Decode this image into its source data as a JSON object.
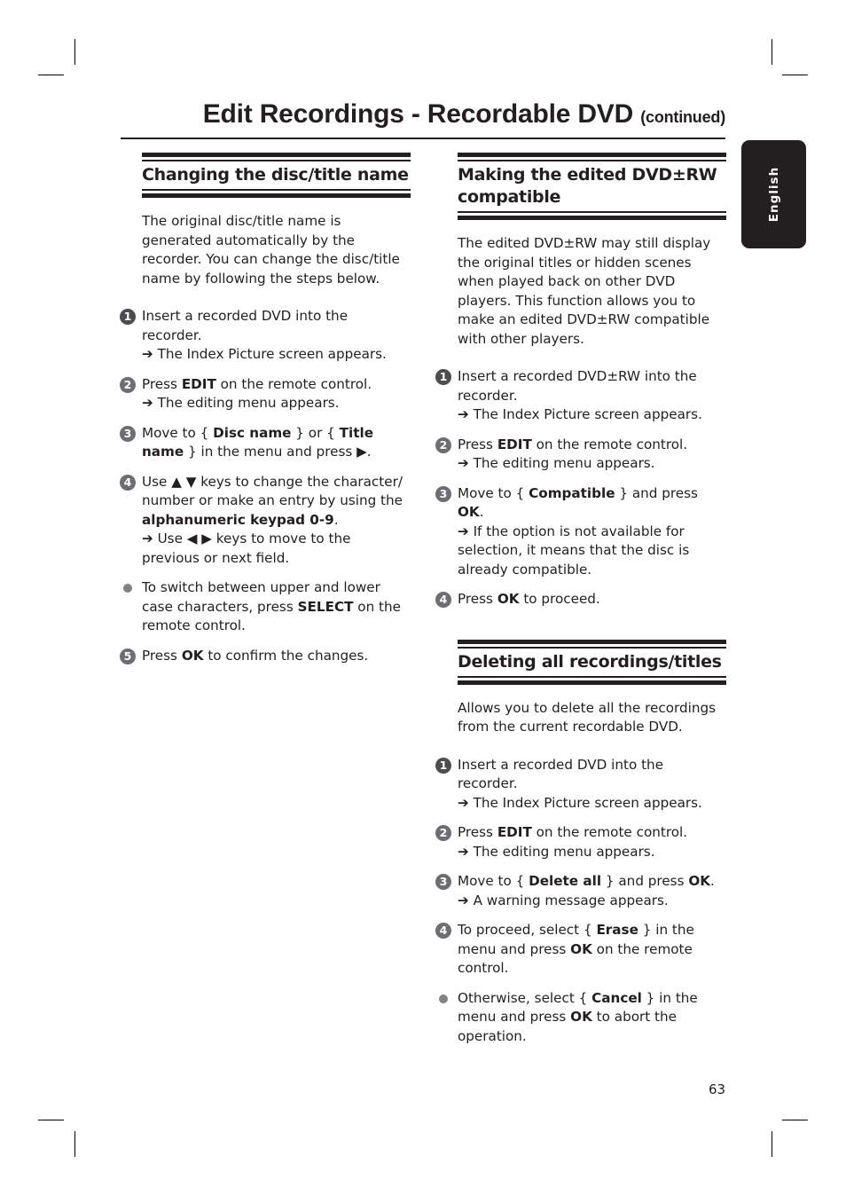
{
  "page": {
    "title": "Edit Recordings - Recordable DVD",
    "title_suffix": "(continued)",
    "language_tab": "English",
    "page_number": "63"
  },
  "left_column": {
    "section_title": "Changing the disc/title name",
    "intro": "The original disc/title name is generated automatically by the recorder. You can change the disc/title name by following the steps below.",
    "steps": [
      {
        "marker": "1",
        "parts": [
          {
            "t": "Insert a recorded DVD into the recorder."
          }
        ],
        "result": "The Index Picture screen appears."
      },
      {
        "marker": "2",
        "parts": [
          {
            "t": "Press "
          },
          {
            "b": "EDIT"
          },
          {
            "t": " on the remote control."
          }
        ],
        "result": "The editing menu appears."
      },
      {
        "marker": "3",
        "parts": [
          {
            "t": "Move to { "
          },
          {
            "b": "Disc name"
          },
          {
            "t": " } or { "
          },
          {
            "b": "Title name"
          },
          {
            "t": " } in the menu and press ▶."
          }
        ]
      },
      {
        "marker": "4",
        "parts": [
          {
            "t": "Use ▲ ▼ keys to change the character/ number or make an entry by using the "
          },
          {
            "b": "alphanumeric keypad 0-9"
          },
          {
            "t": "."
          }
        ],
        "result": "Use ◀ ▶ keys to move to the previous or next field."
      },
      {
        "marker": "bullet",
        "parts": [
          {
            "t": "To switch between upper and lower case characters, press "
          },
          {
            "b": "SELECT"
          },
          {
            "t": " on the remote control."
          }
        ]
      },
      {
        "marker": "5",
        "parts": [
          {
            "t": "Press "
          },
          {
            "b": "OK"
          },
          {
            "t": " to confirm the changes."
          }
        ]
      }
    ]
  },
  "right_column": {
    "sections": [
      {
        "section_title": "Making the edited DVD±RW compatible",
        "intro": "The edited DVD±RW may still display the original titles or hidden scenes when played back on other DVD players. This function allows you to make an edited DVD±RW compatible with other players.",
        "steps": [
          {
            "marker": "1",
            "parts": [
              {
                "t": "Insert a recorded DVD±RW into the recorder."
              }
            ],
            "result": "The Index Picture screen appears."
          },
          {
            "marker": "2",
            "parts": [
              {
                "t": "Press "
              },
              {
                "b": "EDIT"
              },
              {
                "t": " on the remote control."
              }
            ],
            "result": "The editing menu appears."
          },
          {
            "marker": "3",
            "parts": [
              {
                "t": "Move to { "
              },
              {
                "b": "Compatible"
              },
              {
                "t": " } and press "
              },
              {
                "b": "OK"
              },
              {
                "t": "."
              }
            ],
            "result": "If the option is not available for selection, it means that the disc is already compatible."
          },
          {
            "marker": "4",
            "parts": [
              {
                "t": "Press "
              },
              {
                "b": "OK"
              },
              {
                "t": " to proceed."
              }
            ]
          }
        ]
      },
      {
        "section_title": "Deleting all recordings/titles",
        "intro": "Allows you to delete all the recordings from the current recordable DVD.",
        "steps": [
          {
            "marker": "1",
            "parts": [
              {
                "t": "Insert a recorded DVD into the recorder."
              }
            ],
            "result": "The Index Picture screen appears."
          },
          {
            "marker": "2",
            "parts": [
              {
                "t": "Press "
              },
              {
                "b": "EDIT"
              },
              {
                "t": " on the remote control."
              }
            ],
            "result": "The editing menu appears."
          },
          {
            "marker": "3",
            "parts": [
              {
                "t": "Move to { "
              },
              {
                "b": "Delete all"
              },
              {
                "t": " } and press "
              },
              {
                "b": "OK"
              },
              {
                "t": "."
              }
            ],
            "result": "A warning message appears."
          },
          {
            "marker": "4",
            "parts": [
              {
                "t": "To proceed, select { "
              },
              {
                "b": "Erase"
              },
              {
                "t": " } in the menu and press "
              },
              {
                "b": "OK"
              },
              {
                "t": " on the remote control."
              }
            ]
          },
          {
            "marker": "bullet",
            "parts": [
              {
                "t": "Otherwise, select { "
              },
              {
                "b": "Cancel"
              },
              {
                "t": " } in the menu and press "
              },
              {
                "b": "OK"
              },
              {
                "t": " to abort the operation."
              }
            ]
          }
        ]
      }
    ]
  },
  "icons": {
    "result_arrow": "➔"
  }
}
